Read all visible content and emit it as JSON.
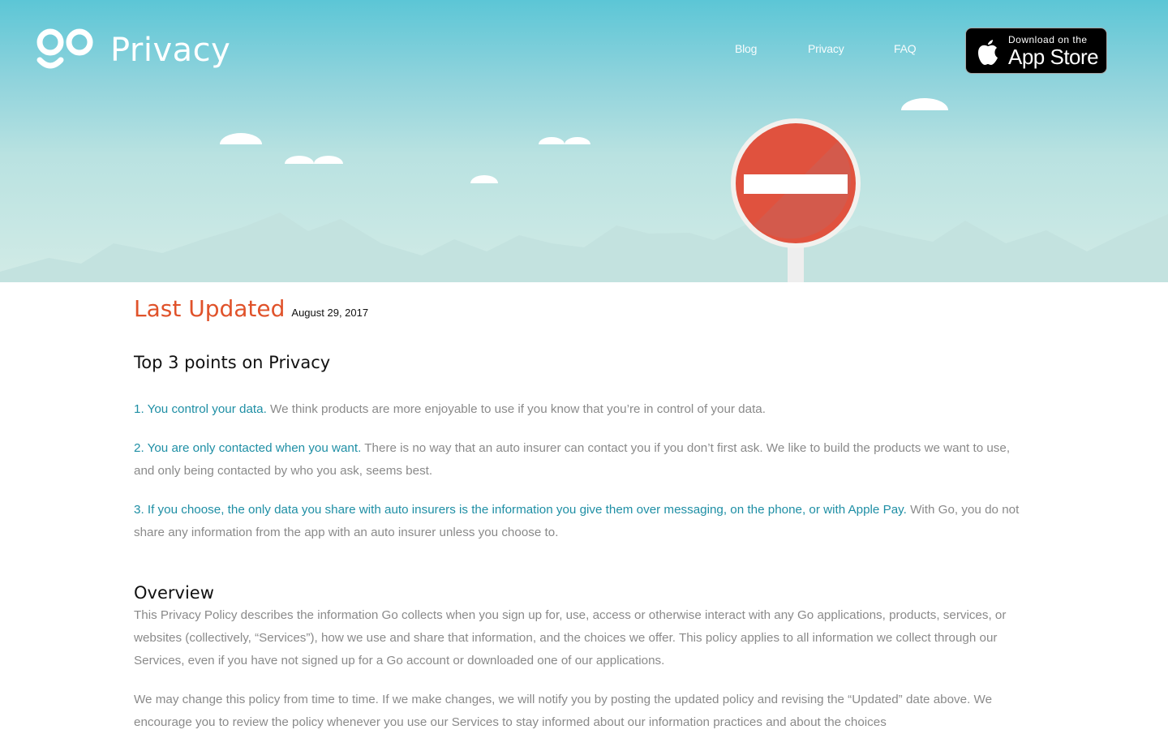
{
  "header": {
    "logo_text": "Privacy",
    "nav": [
      {
        "label": "Blog"
      },
      {
        "label": "Privacy"
      },
      {
        "label": "FAQ"
      }
    ],
    "app_store": {
      "line1": "Download on the",
      "line2": "App Store"
    }
  },
  "hero": {
    "sign_icon": "no-entry-sign-icon",
    "colors": {
      "sky_top": "#5cc6d6",
      "sky_bottom": "#d2ebe6",
      "sign_red": "#e0523e"
    }
  },
  "content": {
    "last_updated_label": "Last Updated",
    "last_updated_date": "August 29, 2017",
    "top_points_title": "Top 3 points on Privacy",
    "points": [
      {
        "lead": "1. You control your data.",
        "text": " We think products are more enjoyable to use if you know that you’re in control of your data."
      },
      {
        "lead": "2. You are only contacted when you want.",
        "text": " There is no way that an auto insurer can contact you if you don’t first ask. We like to build the products we want to use, and only being contacted by who you ask, seems best."
      },
      {
        "lead": "3. If you choose, the only data you share with auto insurers is the information you give them over messaging, on the phone, or with Apple Pay.",
        "text": " With Go, you do not share any information from the app with an auto insurer unless you choose to."
      }
    ],
    "overview_title": "Overview",
    "overview_paragraphs": [
      "This Privacy Policy describes the information Go collects when you sign up for, use, access or otherwise interact with any Go applications, products, services, or websites (collectively, “Services”), how we use and share that information, and the choices we offer. This policy applies to all information we collect through our Services, even if you have not signed up for a Go account or downloaded one of our applications.",
      "We may change this policy from time to time. If we make changes, we will notify you by posting the updated policy and revising the “Updated” date above. We encourage you to review the policy whenever you use our Services to stay informed about our information practices and about the choices"
    ],
    "colors": {
      "accent": "#e0522a",
      "link": "#1f8fa5",
      "body_text": "#8a8a8a"
    }
  }
}
